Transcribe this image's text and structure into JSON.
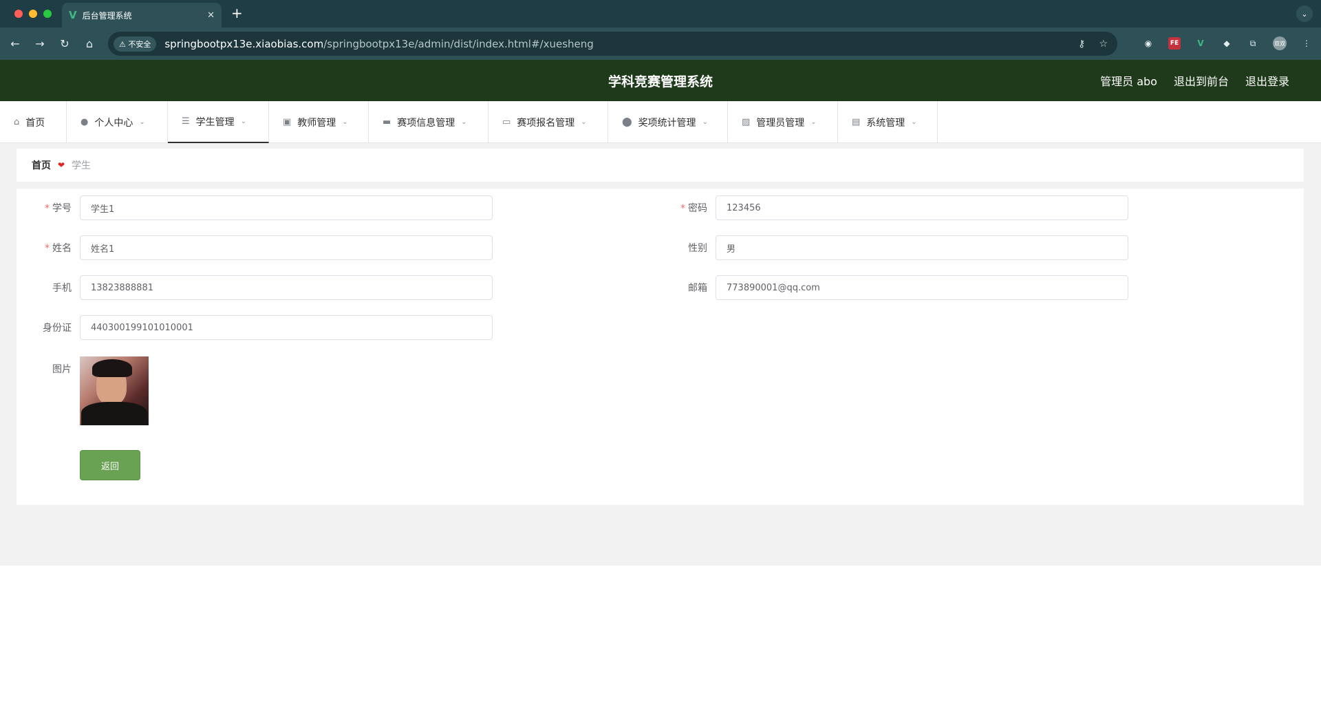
{
  "browser": {
    "tab_title": "后台管理系统",
    "tab_favicon": "V",
    "new_tab": "+",
    "close_tab": "✕",
    "tab_menu": "⌄",
    "security_label": "⚠ 不安全",
    "url_host": "springbootpx13e.xiaobias.com",
    "url_path": "/springbootpx13e/admin/dist/index.html#/xuesheng",
    "nav": {
      "back": "←",
      "forward": "→",
      "reload": "↻",
      "home": "⌂"
    },
    "omni_icons": {
      "key": "⚷",
      "star": "☆"
    },
    "extensions": {
      "ext1": "◉",
      "fe": "FE",
      "vue": "V",
      "ext3": "◆",
      "puzzle": "⧉",
      "menu": "⋮",
      "profile": "双双"
    }
  },
  "header": {
    "title": "学科竞赛管理系统",
    "admin_label": "管理员 abo",
    "to_front": "退出到前台",
    "logout": "退出登录"
  },
  "nav": {
    "items": [
      {
        "label": "首页",
        "icon": "⌂",
        "has_dropdown": false
      },
      {
        "label": "个人中心",
        "icon": "●",
        "has_dropdown": true
      },
      {
        "label": "学生管理",
        "icon": "☰",
        "has_dropdown": true,
        "active": true
      },
      {
        "label": "教师管理",
        "icon": "▣",
        "has_dropdown": true
      },
      {
        "label": "赛项信息管理",
        "icon": "▬",
        "has_dropdown": true
      },
      {
        "label": "赛项报名管理",
        "icon": "▭",
        "has_dropdown": true
      },
      {
        "label": "奖项统计管理",
        "icon": "⬤",
        "has_dropdown": true
      },
      {
        "label": "管理员管理",
        "icon": "▨",
        "has_dropdown": true
      },
      {
        "label": "系统管理",
        "icon": "▤",
        "has_dropdown": true
      }
    ],
    "chevron": "⌄"
  },
  "breadcrumb": {
    "home": "首页",
    "separator": "❤",
    "current": "学生"
  },
  "form": {
    "xuehao": {
      "label": "学号",
      "value": "学生1",
      "required": true
    },
    "mima": {
      "label": "密码",
      "value": "123456",
      "required": true
    },
    "xingming": {
      "label": "姓名",
      "value": "姓名1",
      "required": true
    },
    "xingbie": {
      "label": "性别",
      "value": "男",
      "required": false
    },
    "shouji": {
      "label": "手机",
      "value": "13823888881",
      "required": false
    },
    "youxiang": {
      "label": "邮箱",
      "value": "773890001@qq.com",
      "required": false
    },
    "shenfenzheng": {
      "label": "身份证",
      "value": "440300199101010001",
      "required": false
    },
    "tupian": {
      "label": "图片"
    },
    "required_mark": "*",
    "back_button": "返回"
  },
  "colors": {
    "header_bg": "#1e3a1a",
    "accent_button": "#6aa253",
    "required": "#f56c6c",
    "breadcrumb_heart": "#e02424"
  }
}
